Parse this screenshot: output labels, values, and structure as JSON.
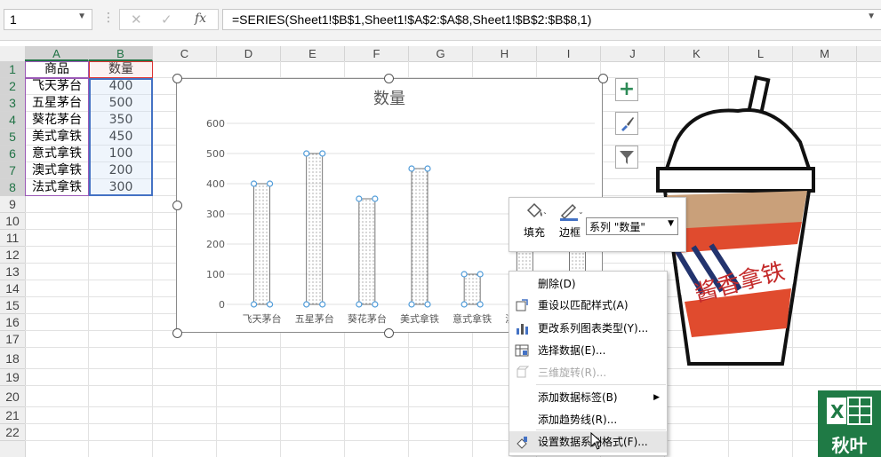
{
  "formula_bar": {
    "name_box": "1",
    "fx_label": "fx",
    "formula": "=SERIES(Sheet1!$B$1,Sheet1!$A$2:$A$8,Sheet1!$B$2:$B$8,1)"
  },
  "columns": [
    "A",
    "B",
    "C",
    "D",
    "E",
    "F",
    "G",
    "H",
    "I",
    "J",
    "K",
    "L",
    "M"
  ],
  "rows": [
    "1",
    "2",
    "3",
    "4",
    "5",
    "6",
    "7",
    "8",
    "9",
    "10",
    "11",
    "12",
    "13",
    "14",
    "15",
    "16",
    "17",
    "18",
    "19",
    "20",
    "21",
    "22"
  ],
  "table": {
    "headers": [
      "商品",
      "数量"
    ],
    "rows": [
      [
        "飞天茅台",
        "400"
      ],
      [
        "五星茅台",
        "500"
      ],
      [
        "葵花茅台",
        "350"
      ],
      [
        "美式拿铁",
        "450"
      ],
      [
        "意式拿铁",
        "100"
      ],
      [
        "澳式拿铁",
        "200"
      ],
      [
        "法式拿铁",
        "300"
      ]
    ]
  },
  "chart_data": {
    "type": "bar",
    "title": "数量",
    "categories": [
      "飞天茅台",
      "五星茅台",
      "葵花茅台",
      "美式拿铁",
      "意式拿铁",
      "澳式拿铁",
      "法式拿铁"
    ],
    "series": [
      {
        "name": "数量",
        "values": [
          400,
          500,
          350,
          450,
          100,
          200,
          300
        ]
      }
    ],
    "yticks": [
      "0",
      "100",
      "200",
      "300",
      "400",
      "500",
      "600"
    ],
    "ylim": [
      0,
      600
    ],
    "grid": true,
    "legend": "none"
  },
  "chart_tools": {
    "add_element": "+",
    "style": "brush",
    "filter": "filter"
  },
  "mini_toolbar": {
    "fill_label": "填充",
    "border_label": "边框",
    "series_selector": "系列 \"数量\""
  },
  "context_menu": [
    {
      "label": "删除(D)",
      "icon": "delete-icon",
      "enabled": true
    },
    {
      "label": "重设以匹配样式(A)",
      "icon": "reset-style-icon",
      "enabled": true
    },
    {
      "label": "更改系列图表类型(Y)...",
      "icon": "chart-type-icon",
      "enabled": true
    },
    {
      "label": "选择数据(E)...",
      "icon": "select-data-icon",
      "enabled": true
    },
    {
      "label": "三维旋转(R)...",
      "icon": "rotate-3d-icon",
      "enabled": false
    },
    {
      "label": "添加数据标签(B)",
      "icon": "",
      "enabled": true,
      "submenu": true
    },
    {
      "label": "添加趋势线(R)...",
      "icon": "",
      "enabled": true
    },
    {
      "label": "设置数据系列格式(F)...",
      "icon": "format-series-icon",
      "enabled": true,
      "hover": true
    }
  ],
  "sticker_text": "酱香拿铁",
  "badge_text": "秋叶",
  "colors": {
    "excel_green": "#217346",
    "selection_blue": "#4472c4",
    "handle_blue": "#4f9bd9",
    "badge_green": "#1f7a45"
  }
}
